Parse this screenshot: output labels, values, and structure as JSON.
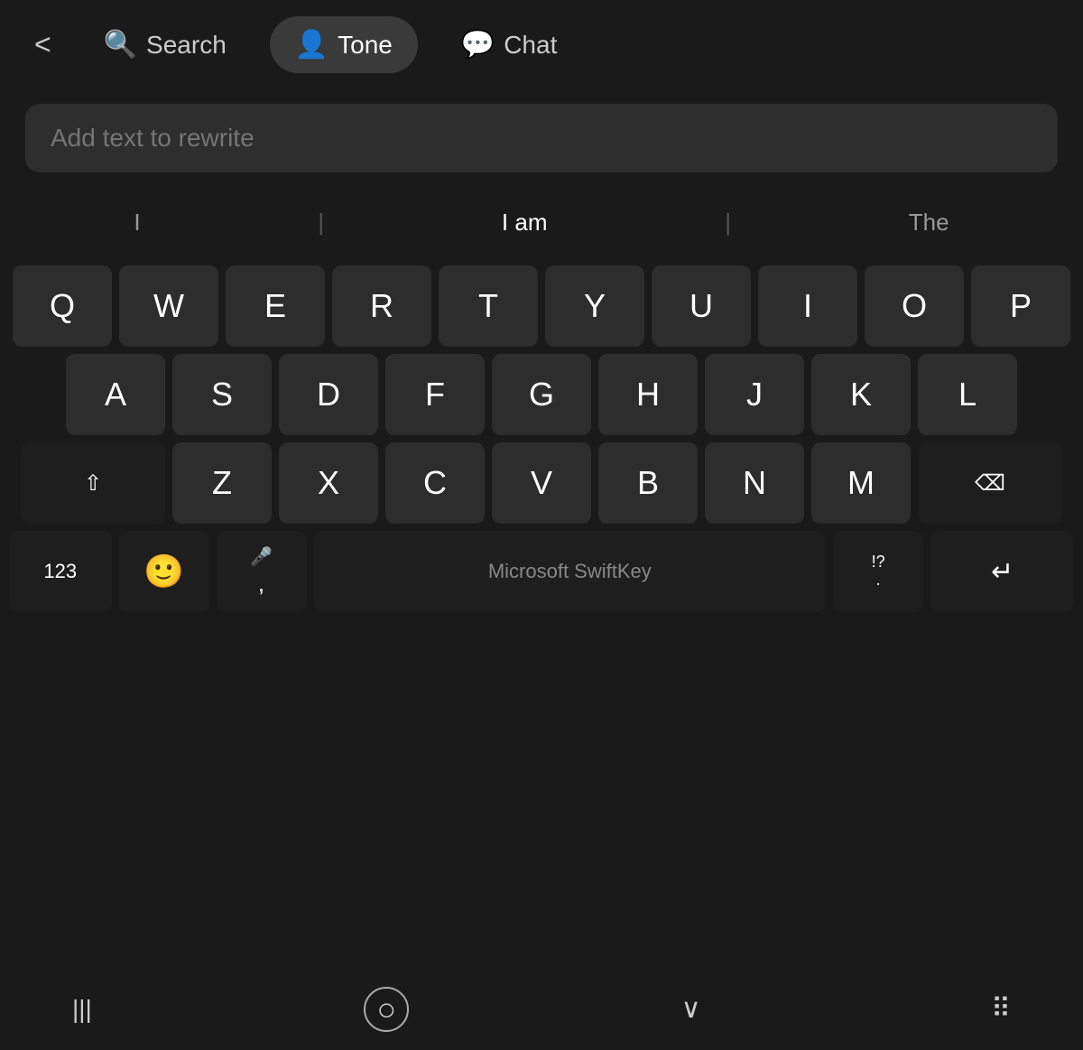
{
  "nav": {
    "back_label": "<",
    "search_label": "Search",
    "tone_label": "Tone",
    "chat_label": "Chat"
  },
  "input": {
    "placeholder": "Add text to rewrite"
  },
  "suggestions": {
    "left": "I",
    "center": "I am",
    "right": "The"
  },
  "keyboard": {
    "row1": [
      "Q",
      "W",
      "E",
      "R",
      "T",
      "Y",
      "U",
      "I",
      "O",
      "P"
    ],
    "row2": [
      "A",
      "S",
      "D",
      "F",
      "G",
      "H",
      "J",
      "K",
      "L"
    ],
    "row3": [
      "Z",
      "X",
      "C",
      "V",
      "B",
      "N",
      "M"
    ],
    "num_key": "123",
    "punctuation_key": ".,!?",
    "space_label": "Microsoft SwiftKey",
    "mic_icon": "🎤",
    "comma_key": ",",
    "punct_key": "!?",
    "period_key": "."
  },
  "systembar": {
    "recent_icon": "|||",
    "home_icon": "○",
    "back_icon": "∨",
    "apps_icon": "⠿"
  }
}
